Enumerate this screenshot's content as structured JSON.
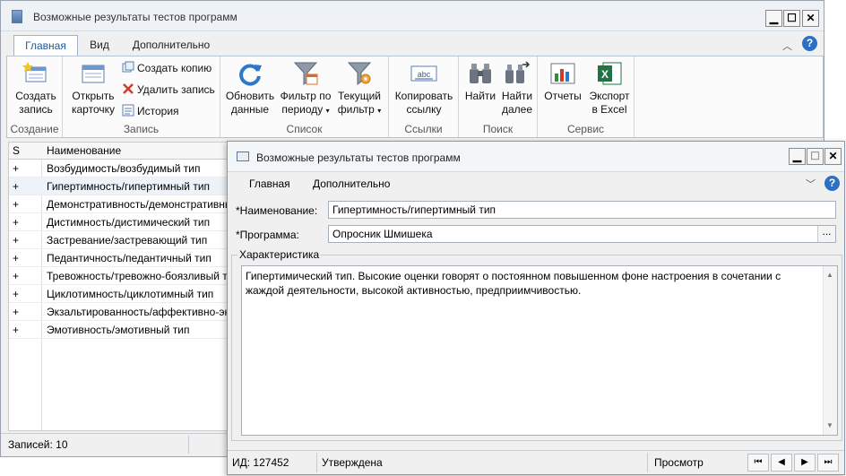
{
  "main_window": {
    "title": "Возможные результаты тестов программ",
    "tabs": [
      "Главная",
      "Вид",
      "Дополнительно"
    ],
    "ribbon": {
      "create_group": {
        "label": "Создание",
        "create_line1": "Создать",
        "create_line2": "запись"
      },
      "record_group": {
        "label": "Запись",
        "open_line1": "Открыть",
        "open_line2": "карточку",
        "create_copy": "Создать копию",
        "delete_record": "Удалить запись",
        "history": "История"
      },
      "list_group": {
        "label": "Список",
        "refresh_line1": "Обновить",
        "refresh_line2": "данные",
        "period_line1": "Фильтр по",
        "period_line2": "периоду",
        "current_line1": "Текущий",
        "current_line2": "фильтр"
      },
      "links_group": {
        "label": "Ссылки",
        "copy_line1": "Копировать",
        "copy_line2": "ссылку"
      },
      "search_group": {
        "label": "Поиск",
        "find": "Найти",
        "find_next_line1": "Найти",
        "find_next_line2": "далее"
      },
      "service_group": {
        "label": "Сервис",
        "reports": "Отчеты",
        "export_line1": "Экспорт",
        "export_line2": "в Excel"
      }
    },
    "grid": {
      "col_s": "S",
      "col_name": "Наименование",
      "rows": [
        {
          "s": "+",
          "name": "Возбудимость/возбудимый тип"
        },
        {
          "s": "+",
          "name": "Гипертимность/гипертимный тип"
        },
        {
          "s": "+",
          "name": "Демонстративность/демонстративный тип"
        },
        {
          "s": "+",
          "name": "Дистимность/дистимический тип"
        },
        {
          "s": "+",
          "name": "Застревание/застревающий тип"
        },
        {
          "s": "+",
          "name": "Педантичность/педантичный тип"
        },
        {
          "s": "+",
          "name": "Тревожность/тревожно-боязливый тип"
        },
        {
          "s": "+",
          "name": "Циклотимность/циклотимный тип"
        },
        {
          "s": "+",
          "name": "Экзальтированность/аффективно-экзальтированный тип"
        },
        {
          "s": "+",
          "name": "Эмотивность/эмотивный тип"
        }
      ]
    },
    "status": "Записей: 10",
    "colors": {
      "accent": "#1f57a5",
      "help": "#2d6fc2"
    }
  },
  "dialog": {
    "title": "Возможные результаты тестов программ",
    "menu": [
      "Главная",
      "Дополнительно"
    ],
    "name_label": "*Наименование:",
    "name_value": "Гипертимность/гипертимный тип",
    "program_label": "*Программа:",
    "program_value": "Опросник Шмишека",
    "picker": "...",
    "characteristic_label": "Характеристика",
    "characteristic_line1": "Гипертимический тип. Высокие оценки говорят о постоянном повышенном фоне настроения в сочетании с",
    "characteristic_line2": "жаждой деятельности, высокой активностью, предприимчивостью.",
    "status": {
      "id": "ИД: 127452",
      "state": "Утверждена",
      "mode": "Просмотр"
    }
  }
}
